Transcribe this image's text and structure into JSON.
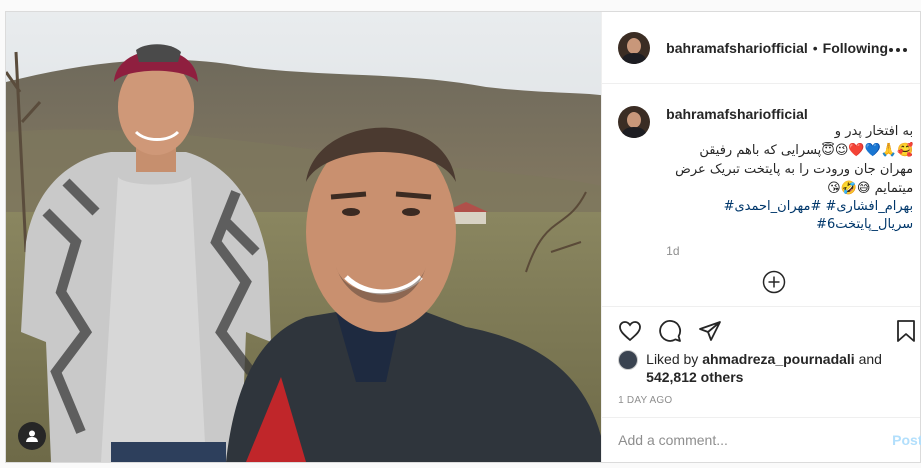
{
  "post": {
    "username": "bahramafshariofficial",
    "separator": "•",
    "follow_status": "Following",
    "more_icon": "more-icon",
    "caption": {
      "username": "bahramafshariofficial",
      "line1": "به افتخار پدر و",
      "line2": "🥰🙏💙❤️😉😇پسرایی که باهم رفیقن",
      "line3": "مهران جان ورودت را به پایتخت تبریک عرض",
      "line4": "میتمایم 😅🤣😘",
      "tags1": "بهرام_افشاری# #مهران_احمدی#",
      "tags2": "سریال_پایتخت6#",
      "time": "1d"
    },
    "likes": {
      "prefix": "Liked by",
      "user": "ahmadreza_pournadali",
      "conj": "and",
      "others": "542,812 others"
    },
    "timestamp": "1 DAY AGO",
    "comment": {
      "placeholder": "Add a comment...",
      "post_label": "Post"
    }
  },
  "colors": {
    "link": "#00376b",
    "muted": "#8e8e8e",
    "post_disabled": "#b2dffc",
    "border": "#dbdbdb"
  }
}
